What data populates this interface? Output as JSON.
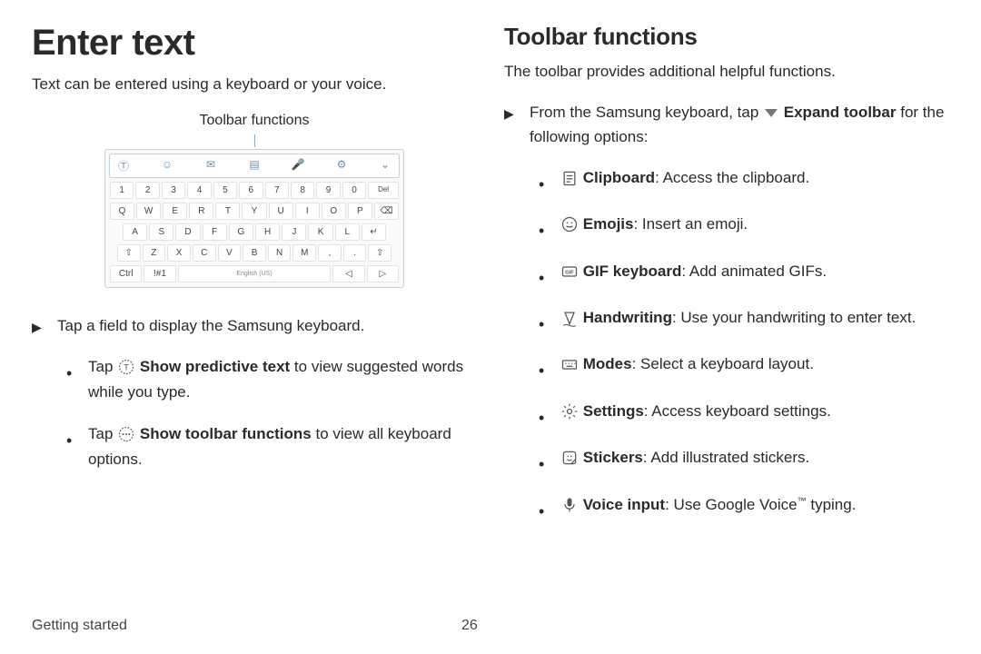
{
  "left": {
    "title": "Enter text",
    "intro": "Text can be entered using a keyboard or your voice.",
    "caption": "Toolbar functions",
    "kb": {
      "row1": [
        "1",
        "2",
        "3",
        "4",
        "5",
        "6",
        "7",
        "8",
        "9",
        "0",
        "Del"
      ],
      "row2": [
        "Q",
        "W",
        "E",
        "R",
        "T",
        "Y",
        "U",
        "I",
        "O",
        "P",
        "⌫"
      ],
      "row3": [
        "A",
        "S",
        "D",
        "F",
        "G",
        "H",
        "J",
        "K",
        "L",
        "↵"
      ],
      "row4": [
        "⇧",
        "Z",
        "X",
        "C",
        "V",
        "B",
        "N",
        "M",
        ",",
        ".",
        "⇧"
      ],
      "space": "English (US)"
    },
    "bullet1": "Tap a field to display the Samsung keyboard.",
    "sub1_pre": "Tap ",
    "sub1_bold": "Show predictive text",
    "sub1_post": " to view suggested words while you type.",
    "sub2_pre": "Tap ",
    "sub2_bold": "Show toolbar functions",
    "sub2_post": " to view all keyboard options."
  },
  "right": {
    "title": "Toolbar functions",
    "intro": "The toolbar provides additional helpful functions.",
    "lead_pre": "From the Samsung keyboard, tap ",
    "lead_bold": "Expand toolbar",
    "lead_post": " for the following options:",
    "items": [
      {
        "bold": "Clipboard",
        "rest": ": Access the clipboard."
      },
      {
        "bold": "Emojis",
        "rest": ": Insert an emoji."
      },
      {
        "bold": "GIF keyboard",
        "rest": ": Add animated GIFs."
      },
      {
        "bold": "Handwriting",
        "rest": ": Use your handwriting to enter text."
      },
      {
        "bold": "Modes",
        "rest": ": Select a keyboard layout."
      },
      {
        "bold": "Settings",
        "rest": ": Access keyboard settings."
      },
      {
        "bold": "Stickers",
        "rest": ": Add illustrated stickers."
      },
      {
        "bold": "Voice input",
        "rest": ": Use Google Voice™ typing."
      }
    ]
  },
  "footer": {
    "section": "Getting started",
    "page": "26"
  }
}
